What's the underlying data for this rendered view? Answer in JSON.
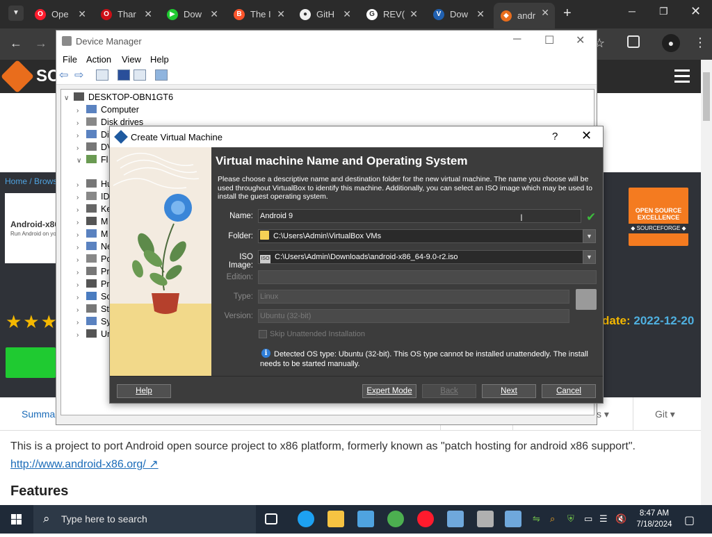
{
  "browser": {
    "tabs": [
      {
        "title": "Ope",
        "icon": "opera-icon",
        "color": "#ff1b2d",
        "glyph": "O"
      },
      {
        "title": "Thar",
        "icon": "opera-icon",
        "color": "#cc0f16",
        "glyph": "O"
      },
      {
        "title": "Dow",
        "icon": "download-arrow-icon",
        "color": "#1fca31",
        "glyph": "▶"
      },
      {
        "title": "The I",
        "icon": "brave-icon",
        "color": "#fb542b",
        "glyph": "B"
      },
      {
        "title": "GitH",
        "icon": "github-icon",
        "color": "#f0f0f0",
        "glyph": "●"
      },
      {
        "title": "REV(",
        "icon": "google-icon",
        "color": "#ffffff",
        "glyph": "G"
      },
      {
        "title": "Dow",
        "icon": "virtualbox-icon",
        "color": "#2060b0",
        "glyph": "V"
      },
      {
        "title": "andr",
        "icon": "sourceforge-icon",
        "color": "#e96d1c",
        "glyph": "◆"
      }
    ],
    "new_tab": "+"
  },
  "sourceforge": {
    "logo_text": "SC",
    "breadcrumb": "Home / Brows",
    "project_title": "Android-x86",
    "project_subtitle": "Run Android on yo",
    "badge_line1": "OPEN SOURCE EXCELLENCE",
    "badge_line2": "◆ SOURCEFORGE ◆",
    "stars": "★★★",
    "update_label": "date:",
    "update_value": "2022-12-20",
    "tab_summary": "Summar",
    "tab_s": "s ▾",
    "tab_git": "Git ▾",
    "description": "This is a project to port Android open source project to x86 platform, formerly known as \"patch hosting for android x86 support\".",
    "link": "http://www.android-x86.org/ ↗",
    "features_heading": "Features"
  },
  "device_manager": {
    "title": "Device Manager",
    "menu": [
      "File",
      "Action",
      "View",
      "Help"
    ],
    "tree_root": "DESKTOP-OBN1GT6",
    "tree": [
      {
        "label": "Computer",
        "expanded": false
      },
      {
        "label": "Disk drives",
        "expanded": false
      },
      {
        "label": "Di",
        "expanded": false
      },
      {
        "label": "DV",
        "expanded": false
      },
      {
        "label": "Fl",
        "expanded": true
      },
      {
        "label": "Hu",
        "expanded": false
      },
      {
        "label": "ID",
        "expanded": false
      },
      {
        "label": "Ke",
        "expanded": false
      },
      {
        "label": "M",
        "expanded": false
      },
      {
        "label": "M",
        "expanded": false
      },
      {
        "label": "Ne",
        "expanded": false
      },
      {
        "label": "Po",
        "expanded": false
      },
      {
        "label": "Pr",
        "expanded": false
      },
      {
        "label": "Pr",
        "expanded": false
      },
      {
        "label": "Sc",
        "expanded": false
      },
      {
        "label": "St",
        "expanded": false
      },
      {
        "label": "Sy",
        "expanded": false
      },
      {
        "label": "Ur",
        "expanded": false
      }
    ]
  },
  "vbox_dialog": {
    "title": "Create Virtual Machine",
    "help_glyph": "?",
    "heading": "Virtual machine Name and Operating System",
    "intro": "Please choose a descriptive name and destination folder for the new virtual machine. The name you choose will be used throughout VirtualBox to identify this machine. Additionally, you can select an ISO image which may be used to install the guest operating system.",
    "name_label": "Name:",
    "name_value": "Android 9",
    "folder_label": "Folder:",
    "folder_value": "C:\\Users\\Admin\\VirtualBox VMs",
    "iso_label": "ISO Image:",
    "iso_badge": "ISO",
    "iso_value": "C:\\Users\\Admin\\Downloads\\android-x86_64-9.0-r2.iso",
    "edition_label": "Edition:",
    "edition_value": "",
    "type_label": "Type:",
    "type_value": "Linux",
    "version_label": "Version:",
    "version_value": "Ubuntu (32-bit)",
    "skip_unattended_label": "Skip Unattended Installation",
    "skip_unattended_checked": false,
    "detected_os_text": "Detected OS type: Ubuntu (32-bit). This OS type cannot be installed unattendedly. The install needs to be started manually.",
    "buttons": {
      "help": "Help",
      "expert": "Expert Mode",
      "back": "Back",
      "next": "Next",
      "cancel": "Cancel"
    }
  },
  "taskbar": {
    "search_placeholder": "Type here to search",
    "time": "8:47 AM",
    "date": "7/18/2024",
    "apps": [
      {
        "icon": "task-view-icon",
        "color": "#ffffff"
      },
      {
        "icon": "edge-icon",
        "color": "#1da1f2"
      },
      {
        "icon": "file-explorer-icon",
        "color": "#f6c342"
      },
      {
        "icon": "microsoft-store-icon",
        "color": "#4fa3e0"
      },
      {
        "icon": "chrome-icon",
        "color": "#4caf50"
      },
      {
        "icon": "opera-icon",
        "color": "#ff1b2d"
      },
      {
        "icon": "vmware-icon",
        "color": "#6fa8dc"
      },
      {
        "icon": "virtualbox-app-icon",
        "color": "#b0b0b0"
      },
      {
        "icon": "virtualbox-manager-icon",
        "color": "#6fa8dc"
      }
    ]
  }
}
